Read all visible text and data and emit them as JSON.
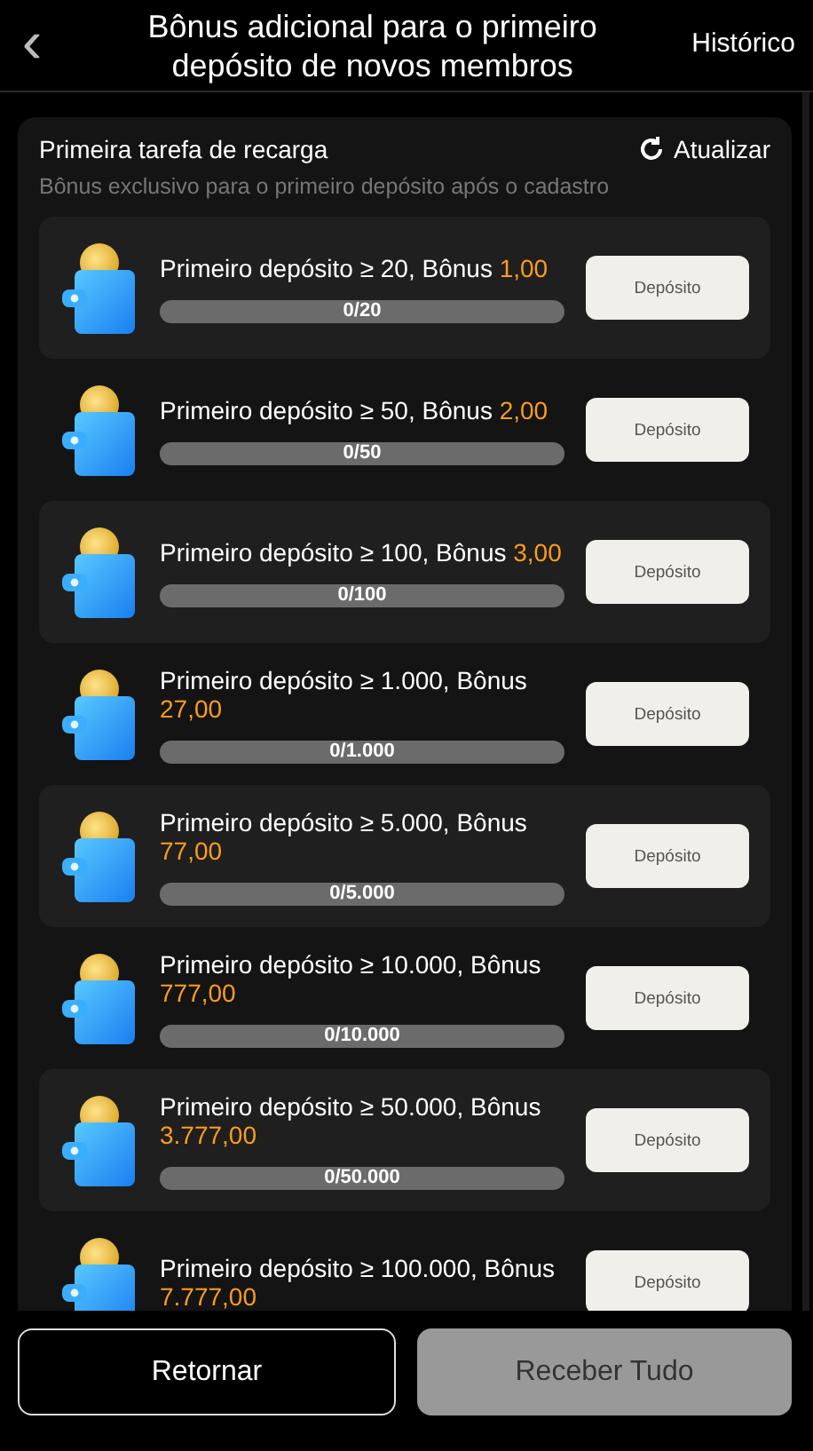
{
  "header": {
    "back": "‹",
    "title": "Bônus adicional para o primeiro depósito de novos membros",
    "history": "Histórico"
  },
  "section": {
    "title": "Primeira tarefa de recarga",
    "refresh": "Atualizar",
    "subtitle": "Bônus exclusivo para o primeiro depósito após o cadastro"
  },
  "tasks": [
    {
      "label": "Primeiro depósito ≥ 20, Bônus",
      "bonus": "1,00",
      "progress": "0/20",
      "level": 0,
      "button": "Depósito"
    },
    {
      "label": "Primeiro depósito ≥ 50, Bônus",
      "bonus": "2,00",
      "progress": "0/50",
      "level": 0,
      "button": "Depósito"
    },
    {
      "label": "Primeiro depósito ≥ 100, Bônus",
      "bonus": "3,00",
      "progress": "0/100",
      "level": 0,
      "button": "Depósito"
    },
    {
      "label": "Primeiro depósito ≥ 1.000, Bônus",
      "bonus": "27,00",
      "progress": "0/1.000",
      "level": 0,
      "button": "Depósito"
    },
    {
      "label": "Primeiro depósito ≥ 5.000, Bônus",
      "bonus": "77,00",
      "progress": "0/5.000",
      "level": 0,
      "button": "Depósito"
    },
    {
      "label": "Primeiro depósito ≥ 10.000, Bônus",
      "bonus": "777,00",
      "progress": "0/10.000",
      "level": 0,
      "button": "Depósito"
    },
    {
      "label": "Primeiro depósito ≥ 50.000, Bônus",
      "bonus": "3.777,00",
      "progress": "0/50.000",
      "level": 0,
      "button": "Depósito"
    },
    {
      "label": "Primeiro depósito ≥ 100.000, Bônus",
      "bonus": "7.777,00",
      "button": "Depósito"
    }
  ],
  "footer": {
    "back_button": "Retornar",
    "claim_button": {
      "label": "Receber Tudo",
      "disabled": true
    }
  }
}
